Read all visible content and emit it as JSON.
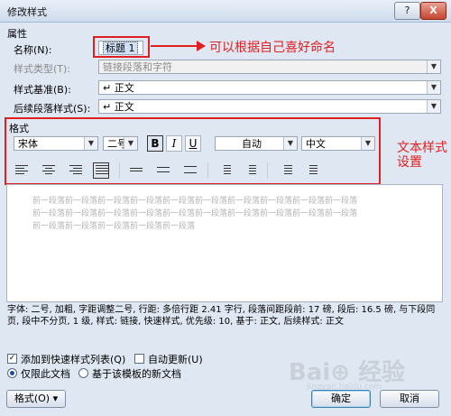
{
  "window": {
    "title": "修改样式",
    "help_glyph": "?",
    "close_glyph": "X"
  },
  "properties": {
    "section_label": "属性",
    "name_label": "名称(N):",
    "name_value": "标题 1",
    "type_label": "样式类型(T):",
    "type_value": "链接段落和字符",
    "base_label": "样式基准(B):",
    "base_value": "↵ 正文",
    "next_label": "后续段落样式(S):",
    "next_value": "↵ 正文"
  },
  "format": {
    "section_label": "格式",
    "font": "宋体",
    "size": "二号",
    "bold_glyph": "B",
    "italic_glyph": "I",
    "underline_glyph": "U",
    "color": "自动",
    "language": "中文"
  },
  "annotations": {
    "name_note": "可以根据自己喜好命名",
    "style_note_line1": "文本样式",
    "style_note_line2": "设置"
  },
  "preview": {
    "sample_line1": "前一段落前一段落前一段落前一段落前一段落前一段落前一段落前一段落前一段落前一段落",
    "sample_line2": "前一段落前一段落前一段落前一段落前一段落前一段落前一段落前一段落前一段落前一段落",
    "sample_line3": "前一段落前一段落前一段落前一段落前一段落"
  },
  "description": "字体: 二号, 加粗, 字距调整二号, 行距: 多倍行距 2.41 字行, 段落间距段前: 17 磅, 段后: 16.5 磅, 与下段同页, 段中不分页, 1 级, 样式: 链接, 快速样式, 优先级: 10, 基于: 正文, 后续样式: 正文",
  "options": {
    "add_quick": "添加到快速样式列表(Q)",
    "auto_update": "自动更新(U)",
    "this_doc": "仅限此文档",
    "new_docs": "基于该模板的新文档"
  },
  "buttons": {
    "format": "格式(O) ▾",
    "ok": "确定",
    "cancel": "取消"
  },
  "watermark": {
    "brand": "Bai⊕ 经验",
    "url": "jingyan.baidu.com"
  },
  "colors": {
    "annotation_red": "#e02020",
    "titlebar": "#cfdcee",
    "dialog_bg": "#dfe7f2"
  }
}
